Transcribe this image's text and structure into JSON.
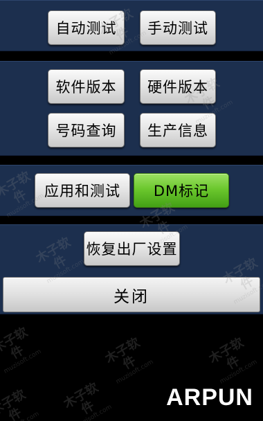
{
  "sections": {
    "top": {
      "auto_test": "自动测试",
      "manual_test": "手动测试"
    },
    "info": {
      "software_version": "软件版本",
      "hardware_version": "硬件版本",
      "number_query": "号码查询",
      "production_info": "生产信息"
    },
    "apps": {
      "app_and_test": "应用和测试",
      "dm_mark": "DM标记"
    },
    "reset": {
      "factory_reset": "恢复出厂设置"
    }
  },
  "close_button": "关闭",
  "brand_logo": "ARPUN",
  "watermark": {
    "text_cn": "木子软件",
    "text_en": "muzisoft.com"
  },
  "colors": {
    "panel_background": "#1c2f4e",
    "screen_background": "#000000",
    "active_button": "#6cc82e"
  }
}
